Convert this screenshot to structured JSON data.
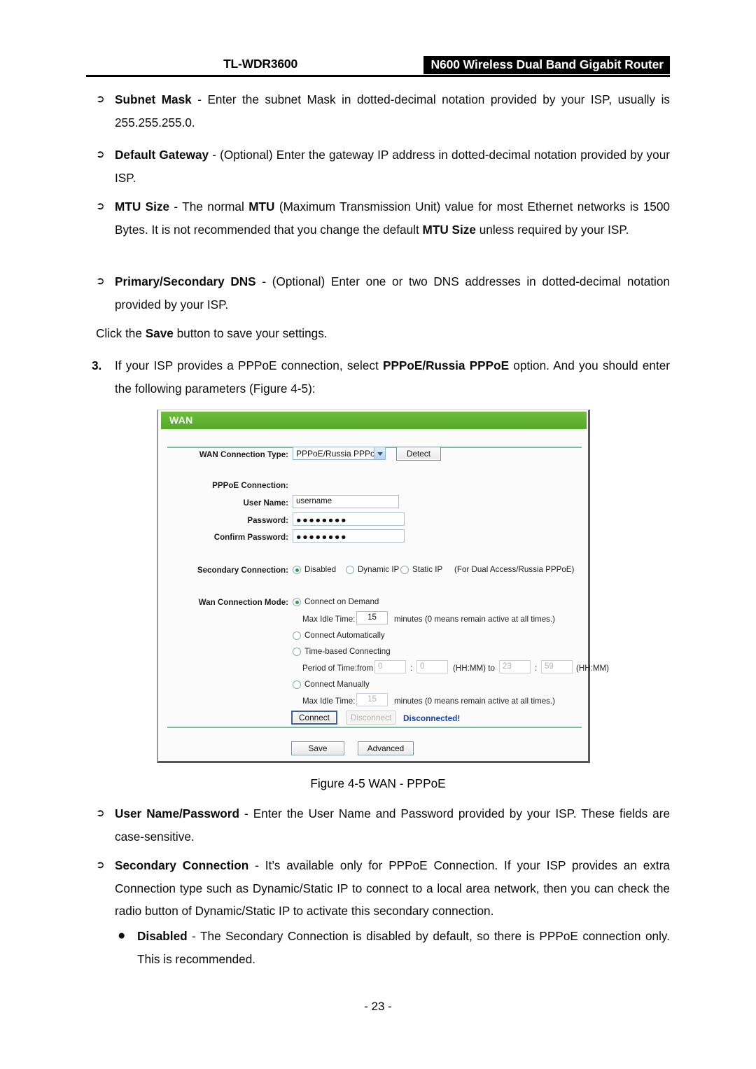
{
  "header": {
    "model": "TL-WDR3600",
    "product": "N600 Wireless Dual Band Gigabit Router"
  },
  "body": {
    "bullet_arrow_glyph": "➢",
    "bullet_dot_glyph": "●",
    "items": [
      {
        "term": "Subnet Mask",
        "dash": " - ",
        "text": "Enter the subnet Mask in dotted-decimal notation provided by your ISP, usually is 255.255.255.0."
      },
      {
        "term": "Default Gateway",
        "dash": " - ",
        "text": "(Optional) Enter the gateway IP address in dotted-decimal notation provided by your ISP."
      },
      {
        "term": "MTU Size",
        "dash": " - ",
        "text": "The normal MTU (Maximum Transmission Unit) value for most Ethernet networks is 1500 Bytes. It is not recommended that you change the default MTU Size unless required by your ISP."
      },
      {
        "term": "Primary/Secondary DNS",
        "dash": " - ",
        "text": "(Optional) Enter one or two DNS addresses in dotted-decimal notation provided by your ISP."
      }
    ],
    "save_note_pre": "Click the ",
    "save_note_bold": "Save",
    "save_note_post": " button to save your settings.",
    "step_number": "3.",
    "step_text_pre": "If your ISP provides a PPPoE connection, select ",
    "step_text_bold": "PPPoE/Russia PPPoE",
    "step_text_post": " option. And you should enter the following parameters (Figure 4-5):",
    "figure_caption": "Figure 4-5 WAN - PPPoE",
    "items2": [
      {
        "term": "User Name/Password",
        "dash": " - ",
        "text": "Enter the User Name and Password provided by your ISP. These fields are case-sensitive."
      },
      {
        "term": "Secondary Connection",
        "dash": " - ",
        "text": "It’s available only for PPPoE Connection. If your ISP provides an extra Connection type such as Dynamic/Static IP to connect to a local area network, then you can check the radio button of Dynamic/Static IP to activate this secondary connection."
      }
    ],
    "subitem": {
      "term": "Disabled",
      "dash": " - ",
      "text": "The Secondary Connection is disabled by default, so there is PPPoE connection only. This is recommended."
    },
    "page_number": "- 23 -"
  },
  "figure": {
    "panel_title": "WAN",
    "accent_green": "#61b233",
    "status_blue": "#1540a8",
    "wan_connection_type_label": "WAN Connection Type:",
    "wan_connection_type_value": "PPPoE/Russia PPPoE",
    "detect_button": "Detect",
    "pppoe_connection_label": "PPPoE Connection:",
    "user_name_label": "User Name:",
    "user_name_value": "username",
    "password_label": "Password:",
    "password_value": "●●●●●●●●",
    "confirm_password_label": "Confirm Password:",
    "confirm_password_value": "●●●●●●●●",
    "secondary_connection_label": "Secondary Connection:",
    "secondary_options": [
      {
        "label": "Disabled",
        "selected": true
      },
      {
        "label": "Dynamic IP",
        "selected": false
      },
      {
        "label": "Static IP",
        "selected": false
      }
    ],
    "secondary_note": "(For Dual Access/Russia PPPoE)",
    "wan_connection_mode_label": "Wan Connection Mode:",
    "mode_connect_on_demand": "Connect on Demand",
    "max_idle_time_label_1": "Max Idle Time:",
    "max_idle_time_value_1": "15",
    "max_idle_time_units_1": "minutes (0 means remain active at all times.)",
    "mode_connect_automatically": "Connect Automatically",
    "mode_time_based": "Time-based Connecting",
    "period_label": "Period of Time:from",
    "period_from_hh": "0",
    "period_colon": ":",
    "period_from_mm": "0",
    "period_hhmm_1": "(HH:MM) to",
    "period_to_hh": "23",
    "period_to_mm": "59",
    "period_hhmm_2": "(HH:MM)",
    "mode_connect_manually": "Connect Manually",
    "max_idle_time_label_2": "Max Idle Time:",
    "max_idle_time_value_2": "15",
    "max_idle_time_units_2": "minutes (0 means remain active at all times.)",
    "connect_button": "Connect",
    "disconnect_button": "Disconnect",
    "connection_status": "Disconnected!",
    "save_button": "Save",
    "advanced_button": "Advanced"
  }
}
